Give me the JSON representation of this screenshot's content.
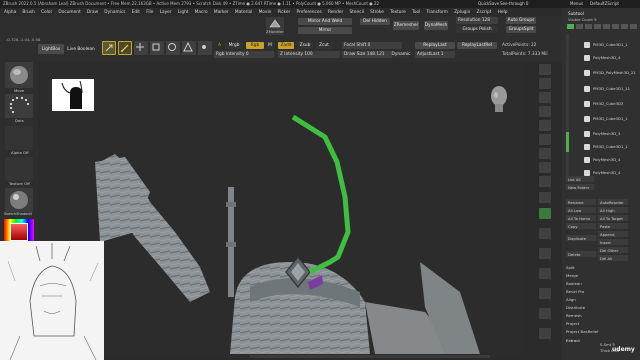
{
  "title_bar": {
    "status": "ZBrush 2022.0.5 [Abraham Leal]   ZBrush Document   • Free Mem 22.163GB • Active Mem 2793 • Scratch Disk 49 • ZTime ● 2.647 RTime ● 1.11 • PolyCount ● 5.060 MP • MeshCount ● 22",
    "right_labels": [
      "QuickSave",
      "See-through 0",
      "Menus",
      "DefaultZScript"
    ]
  },
  "menu_bar": [
    "Alpha",
    "Brush",
    "Color",
    "Document",
    "Draw",
    "Dynamics",
    "Edit",
    "File",
    "Layer",
    "Light",
    "Macro",
    "Marker",
    "Material",
    "Movie",
    "Picker",
    "Preferences",
    "Render",
    "Stencil",
    "Stroke",
    "Texture",
    "Tool",
    "Transform",
    "Zplugin",
    "Zscript",
    "Help"
  ],
  "coords": "-0.726,-1.04,-0.58",
  "top_shelf": {
    "lightbox": "LightBox",
    "live_boolean": "Live Boolean",
    "tool_icons": [
      "Edit",
      "Draw",
      "Move",
      "Scale",
      "Rotate"
    ],
    "a_label": "A",
    "mrgb": "Mrgb",
    "rgb": "Rgb",
    "m": "M",
    "zadd": "Zadd",
    "zsub": "Zsub",
    "zcut": "Zcut",
    "rgb_intensity": "Rgb Intensity 0",
    "z_intensity": "Z Intensity 100",
    "mirror_and_weld": "Mirror And Weld",
    "mirror": "Mirror",
    "del_hidden": "Del Hidden",
    "zremesher": "ZRemesher",
    "dynamesh": "DynaMesh",
    "resolution": "Resolution 128",
    "auto_groups": "Auto Groups",
    "groups_polish": "Groups  Polish",
    "group_split": "GroupsSplit",
    "focal_shift": "Focal Shift 0",
    "draw_size": "Draw Size 148.121",
    "dynamic": "Dynamic",
    "replay_last": "ReplayLast",
    "replay_last_rel": "ReplayLastRel",
    "active_points": "ActivePoints: 22",
    "adjust_last": "AdjustLast 1",
    "total_points": "TotalPoints: 7.333 Mil",
    "zmodeler": "ZModeler"
  },
  "left_shelf": {
    "brush_label": "Move",
    "dots_label": "Dots",
    "alpha_label": "Alpha Off",
    "texture_label": "Texture Off",
    "material_label": "SketchShaded4"
  },
  "right_tray": {
    "subtool_title": "Subtool",
    "visible_count": "Visible Count 9",
    "subtools": [
      "PM3D_Cube3D1_1",
      "PolyMesh3D_4",
      "PM3D_PolyMesh3D_21",
      "PM3D_Cube3D1_11",
      "PM3D_Cube3D3",
      "PM3D_Cube3D1_1",
      "PolyMesh3D_3",
      "PM3D_Cube3D1_1",
      "PolyMesh3D_4",
      "PolyMesh3D_4"
    ],
    "list_all": "List All",
    "new_folder": "New Folder",
    "ops": [
      [
        "Rename",
        "AutoReorder"
      ],
      [
        "All Low",
        "All High"
      ],
      [
        "All To Home",
        "All To Target"
      ],
      [
        "Copy",
        "Paste"
      ],
      [
        "Duplicate",
        "Append"
      ],
      [
        "",
        "Insert"
      ],
      [
        "Delete",
        "Del Other"
      ],
      [
        "",
        "Del All"
      ]
    ],
    "menu_items": [
      "Split",
      "Merge",
      "Boolean",
      "Bevel Pro",
      "Align",
      "Distribute",
      "Remesh",
      "Project",
      "Project BasRelief",
      "Extract"
    ],
    "footer_value": "S.Smt 5",
    "footer_thick": "Thick 0.02"
  },
  "right_shelf_icons": [
    "Bpr",
    "SPix 3",
    "Scroll",
    "Zoom",
    "Actual",
    "AAHalf",
    "Persp",
    "Floor",
    "Local",
    "Frame",
    "Move",
    "Zoom3D",
    "Rotate",
    "Transp",
    "Ghost",
    "Solo",
    "Xpose"
  ],
  "watermark": "udemy",
  "colors": {
    "accent_orange": "#e08a2a",
    "stroke_green": "#3fbf3f",
    "active_yellow": "#c9a227",
    "sculpt_gray": "#8c9296"
  }
}
